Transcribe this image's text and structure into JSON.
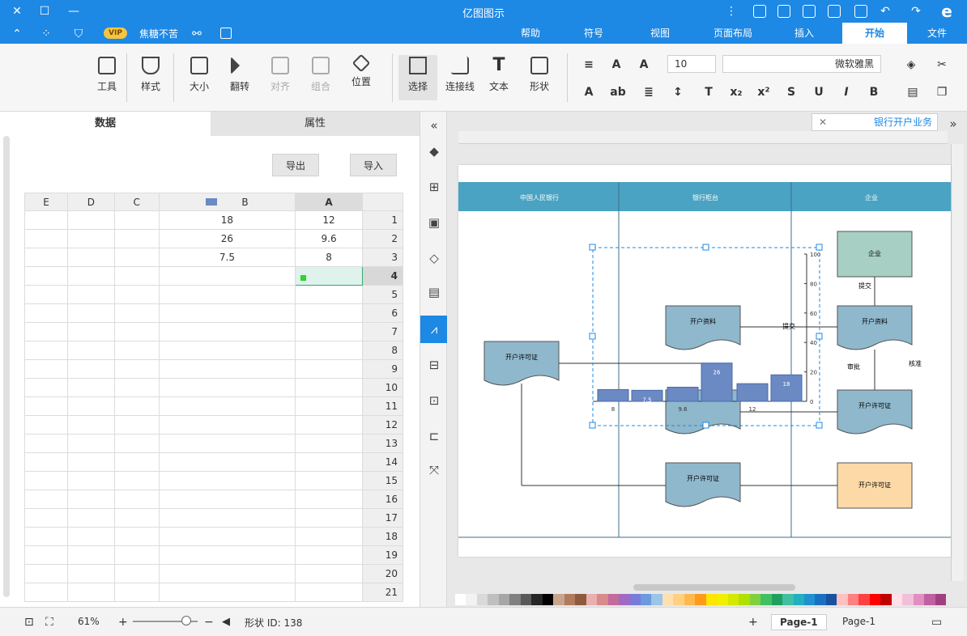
{
  "app": {
    "title": "亿图图示",
    "user": "焦糖不苦",
    "vip": "VIP"
  },
  "tabs": [
    "文件",
    "开始",
    "插入",
    "页面布局",
    "视图",
    "符号",
    "帮助"
  ],
  "active_tab": "开始",
  "ribbon": {
    "font_name": "微软雅黑",
    "font_size": "10",
    "tools": [
      "选择",
      "连接线",
      "文本",
      "形状",
      "位置",
      "组合",
      "对齐",
      "翻转",
      "大小",
      "样式",
      "工具"
    ]
  },
  "left_panel": {
    "tab_data": "数据",
    "tab_props": "属性",
    "btn_import": "导入",
    "btn_export": "导出",
    "columns": [
      "A",
      "B",
      "C",
      "D",
      "E"
    ],
    "rows": [
      {
        "n": "1",
        "a": "12",
        "b": "18"
      },
      {
        "n": "2",
        "a": "9.6",
        "b": "26"
      },
      {
        "n": "3",
        "a": "8",
        "b": "7.5"
      },
      {
        "n": "4",
        "a": "",
        "b": ""
      },
      {
        "n": "5",
        "a": "",
        "b": ""
      },
      {
        "n": "6",
        "a": "",
        "b": ""
      },
      {
        "n": "7",
        "a": "",
        "b": ""
      },
      {
        "n": "8",
        "a": "",
        "b": ""
      },
      {
        "n": "9",
        "a": "",
        "b": ""
      },
      {
        "n": "10",
        "a": "",
        "b": ""
      },
      {
        "n": "11",
        "a": "",
        "b": ""
      },
      {
        "n": "12",
        "a": "",
        "b": ""
      },
      {
        "n": "13",
        "a": "",
        "b": ""
      },
      {
        "n": "14",
        "a": "",
        "b": ""
      },
      {
        "n": "15",
        "a": "",
        "b": ""
      },
      {
        "n": "16",
        "a": "",
        "b": ""
      },
      {
        "n": "17",
        "a": "",
        "b": ""
      },
      {
        "n": "18",
        "a": "",
        "b": ""
      },
      {
        "n": "19",
        "a": "",
        "b": ""
      },
      {
        "n": "20",
        "a": "",
        "b": ""
      },
      {
        "n": "21",
        "a": "",
        "b": ""
      }
    ]
  },
  "canvas": {
    "doc_tab": "银行开户业务",
    "lanes": [
      "企业",
      "银行柜台",
      "中国人民银行"
    ],
    "shapes": {
      "enterprise": "企业",
      "open_account": "开户资料",
      "bank_review": "开户资料",
      "license": "开户许可证",
      "license2": "开户许可证",
      "license3": "开户许可证",
      "enterprise_license": "开户许可证",
      "submit": "提交",
      "submit2": "提交",
      "review": "审批",
      "audit": "核准"
    },
    "chart_labels": [
      "100",
      "80",
      "60",
      "40",
      "20",
      "0"
    ]
  },
  "chart_data": {
    "type": "bar",
    "categories": [
      "1",
      "2",
      "3"
    ],
    "series": [
      {
        "name": "A",
        "values": [
          12,
          9.6,
          8
        ]
      },
      {
        "name": "B",
        "values": [
          18,
          26,
          7.5
        ]
      }
    ],
    "ylim": [
      0,
      100
    ]
  },
  "status": {
    "page_select": "Page-1",
    "page_tab": "Page-1",
    "add_page": "+",
    "shape_id": "形状 ID: 138",
    "zoom": "61%"
  },
  "colors": {
    "accent": "#1e88e5",
    "lane_header": "#4aa3c2",
    "shape_blue": "#8fb8cc",
    "shape_green": "#a8cfc4",
    "shape_orange": "#fcd9a6",
    "bar": "#6b8ac4"
  }
}
